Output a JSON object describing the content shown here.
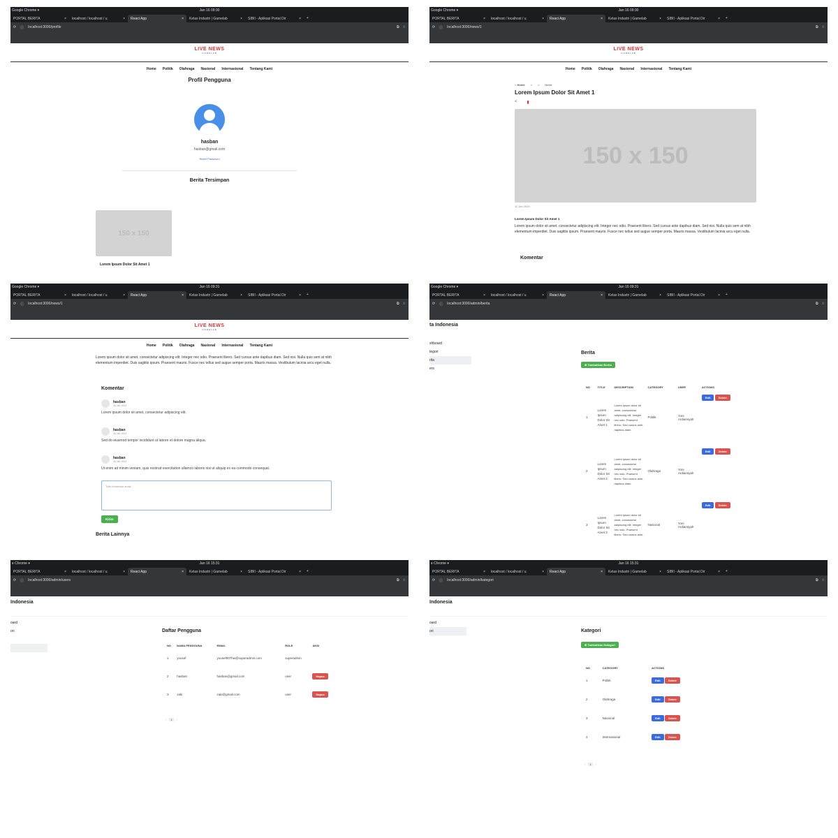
{
  "browser": {
    "app": "Google Chrome ▾",
    "app_short": "e Chrome ▾",
    "times": [
      "Jan 16 09:30",
      "Jan 16 09:30",
      "Jan 16 09:31",
      "Jan 16 09:31",
      "Jan 16 15:31",
      "Jan 16 15:31"
    ],
    "tabs": [
      "PORTAL BERITA",
      "localhost / localhost / u",
      "React App",
      "Kelas Industri | Gamelab",
      "SIBII - Aplikasi Portal Dir"
    ],
    "close": "×",
    "plus": "+",
    "urls": [
      "localhost:3000/profile",
      "localhost:3000/news/1",
      "localhost:3000/news/1",
      "localhost:3000/admin/berita",
      "localhost:3000/admin/users",
      "localhost:3000/admin/kategori"
    ]
  },
  "site": {
    "logo": "LIVE NEWS",
    "logo_sub": "GAMELAB",
    "nav": [
      "Home",
      "Politik",
      "Olahraga",
      "Nasional",
      "Internasional",
      "Tentang Kami"
    ]
  },
  "profile": {
    "title": "Profil Pengguna",
    "name": "hasban",
    "email": "hasban@gmail.com",
    "reset": "Reset Password",
    "saved_title": "Berita Tersimpan",
    "saved_item_title": "Lorem Ipsum Dolor Sit Amet 1",
    "placeholder": "150 x 150"
  },
  "news": {
    "breadcrumb_home": "Home",
    "breadcrumb_sep": ">",
    "breadcrumb_news": "News",
    "title": "Lorem Ipsum Dolor Sit Amet 1",
    "date": "11 Jan 2024",
    "subtitle": "Lorem Ipsum Dolor Sit Amet 1",
    "body": "Lorem ipsum dolor sit amet, consectetur adipiscing elit. Integer nec odio. Praesent libero. Sed cursus ante dapibus diam. Sed nisi. Nulla quis sem at nibh elementum imperdiet. Duis sagittis ipsum. Praesent mauris. Fusce nec tellus sed augue semper porta. Mauris massa. Vestibulum lacinia arcu eget nulla.",
    "comments_title": "Komentar",
    "comments": [
      {
        "user": "hasban",
        "date": "16 Jan 2024",
        "text": "Lorem ipsum dolor sit amet, consectetur adipiscing elit."
      },
      {
        "user": "hasban",
        "date": "16 Jan 2024",
        "text": "Sed do eiusmod tempor incididunt ut labore et dolore magna aliqua."
      },
      {
        "user": "hasban",
        "date": "16 Jan 2024",
        "text": "Ut enim ad minim veniam, quis nostrud exercitation ullamco laboris nisi ut aliquip ex ea commodo consequat."
      }
    ],
    "comment_placeholder": "Tulis komentar anda...",
    "send": "Kirim",
    "more_title": "Berita Lainnya"
  },
  "admin": {
    "brand": "ta Indonesia",
    "brand2": "Indonesia",
    "side_berita": [
      "shboard",
      "tegori",
      "rita",
      "ers"
    ],
    "side_users": [
      "oard",
      "ori"
    ],
    "side_kategori": [
      "oard",
      "ori"
    ],
    "berita": {
      "title": "Berita",
      "add": "Tambahkan Berita",
      "headers": [
        "NO",
        "TITLE",
        "DESCRIPTION",
        "CATEGORY",
        "USER",
        "ACTIONS"
      ],
      "rows": [
        {
          "no": "1",
          "title": "Lorem Ipsum Dolor Sit Amet 1",
          "desc": "Lorem ipsum dolor sit amet, consectetur adipiscing elit. Integer nec odio. Praesent libero. Sed cursus ante dapibus diam.",
          "cat": "Politik",
          "user": "Yoni Ardiansyah"
        },
        {
          "no": "2",
          "title": "Lorem Ipsum Dolor Sit Amet 2",
          "desc": "Lorem ipsum dolor sit amet, consectetur adipiscing elit. Integer nec odio. Praesent libero. Sed cursus ante dapibus diam.",
          "cat": "Olahraga",
          "user": "Yoni Ardiansyah"
        },
        {
          "no": "3",
          "title": "Lorem Ipsum Dolor Sit Amet 3",
          "desc": "Lorem ipsum dolor sit amet, consectetur adipiscing elit. Integer nec odio. Praesent libero. Sed cursus ante",
          "cat": "Nasional",
          "user": "Yoni Ardiansyah"
        }
      ],
      "edit": "Edit",
      "delete": "Delete"
    },
    "users": {
      "title": "Daftar Pengguna",
      "headers": [
        "NO",
        "NAMA PENGGUNA",
        "EMAIL",
        "ROLE",
        "AKSI"
      ],
      "rows": [
        {
          "no": "1",
          "name": "yousef",
          "email": "yousef007hw@superadmin.com",
          "role": "superadmin",
          "action": ""
        },
        {
          "no": "2",
          "name": "hasban",
          "email": "hasban@gmail.com",
          "role": "user",
          "action": "Hapus"
        },
        {
          "no": "3",
          "name": "zaki",
          "email": "zaki@gmail.com",
          "role": "user",
          "action": "Hapus"
        }
      ],
      "page": "1"
    },
    "kategori": {
      "title": "Kategori",
      "add": "Tambahkan Kategori",
      "headers": [
        "NO",
        "CATEGORY",
        "ACTIONS"
      ],
      "rows": [
        {
          "no": "1",
          "cat": "Politik"
        },
        {
          "no": "2",
          "cat": "Olahraga"
        },
        {
          "no": "3",
          "cat": "Nasional"
        },
        {
          "no": "4",
          "cat": "Internasional"
        }
      ],
      "edit": "Edit",
      "delete": "Delete",
      "page": "1"
    }
  },
  "colors": {
    "accent_red": "#d33333",
    "blue": "#3b6be0",
    "green": "#4caf50",
    "danger": "#d9534f"
  }
}
